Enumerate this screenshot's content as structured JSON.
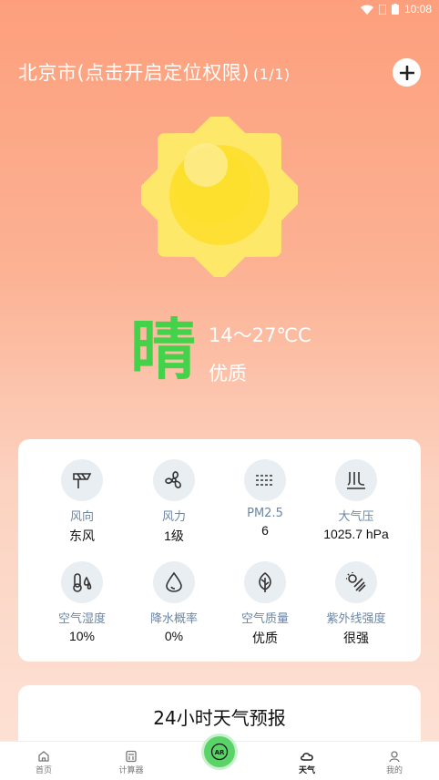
{
  "status_bar": {
    "time": "10:08"
  },
  "header": {
    "location": "北京市(点击开启定位权限)",
    "location_count": "(1/1)"
  },
  "weather": {
    "condition": "晴",
    "temperature": "14～27℃C",
    "air_quality": "优质",
    "icon": "sun-icon"
  },
  "details": [
    {
      "label": "风向",
      "value": "东风",
      "icon": "wind-direction-icon"
    },
    {
      "label": "风力",
      "value": "1级",
      "icon": "fan-icon"
    },
    {
      "label": "PM2.5",
      "value": "6",
      "icon": "haze-icon"
    },
    {
      "label": "大气压",
      "value": "1025.7 hPa",
      "icon": "pressure-icon"
    },
    {
      "label": "空气湿度",
      "value": "10%",
      "icon": "humidity-icon"
    },
    {
      "label": "降水概率",
      "value": "0%",
      "icon": "droplet-icon"
    },
    {
      "label": "空气质量",
      "value": "优质",
      "icon": "leaf-icon"
    },
    {
      "label": "紫外线强度",
      "value": "很强",
      "icon": "uv-icon"
    }
  ],
  "forecast": {
    "title": "24小时天气预报"
  },
  "tabbar": {
    "items": [
      {
        "label": "首页",
        "icon": "home-icon"
      },
      {
        "label": "计算器",
        "icon": "calculator-icon"
      },
      {
        "label": "AR",
        "icon": "ar-icon"
      },
      {
        "label": "天气",
        "icon": "cloud-icon"
      },
      {
        "label": "我的",
        "icon": "user-icon"
      }
    ],
    "active": "天气"
  },
  "colors": {
    "accent_green": "#44d24a",
    "label_blue": "#6b86a5",
    "sun_yellow": "#fde86a"
  }
}
